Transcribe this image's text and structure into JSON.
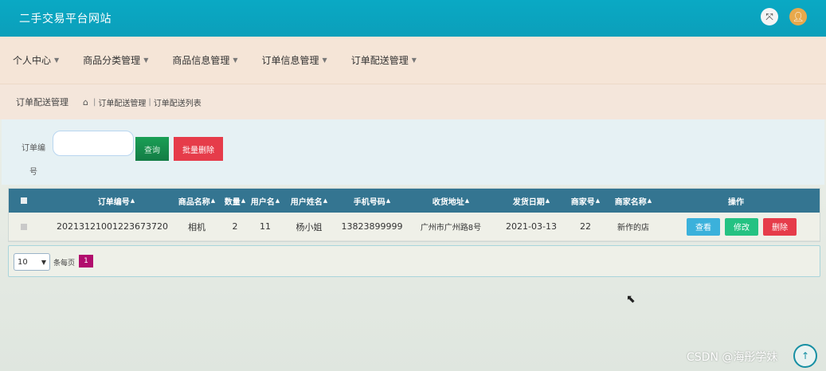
{
  "header": {
    "title": "二手交易平台网站",
    "fullscreen_icon": "fullscreen-icon",
    "user_icon": "user-icon"
  },
  "nav": {
    "items": [
      {
        "label": "个人中心"
      },
      {
        "label": "商品分类管理"
      },
      {
        "label": "商品信息管理"
      },
      {
        "label": "订单信息管理"
      },
      {
        "label": "订单配送管理"
      }
    ]
  },
  "breadcrumb": {
    "current": "订单配送管理",
    "path": [
      "订单配送管理",
      "订单配送列表"
    ]
  },
  "search": {
    "label_line1": "订单编",
    "label_line2": "号",
    "input_value": "",
    "search_label": "查询",
    "batch_delete_label": "批量删除"
  },
  "table": {
    "headers": [
      "订单编号",
      "商品名称",
      "数量",
      "用户名",
      "用户姓名",
      "手机号码",
      "收货地址",
      "发货日期",
      "商家号",
      "商家名称",
      "操作"
    ],
    "rows": [
      {
        "order_no": "20213121001223673720",
        "product": "相机",
        "qty": "2",
        "username": "11",
        "name": "杨小姐",
        "phone": "13823899999",
        "address": "广州市广州路8号",
        "ship_date": "2021-03-13",
        "merchant_no": "22",
        "merchant_name": "新作的店",
        "view_label": "查看",
        "edit_label": "修改",
        "delete_label": "删除"
      }
    ]
  },
  "pager": {
    "page_size": "10",
    "per_page_label": "条每页",
    "current_page": "1"
  },
  "watermark": "CSDN @海彤学妹",
  "colors": {
    "topbar": "#0aa9c4",
    "table_header": "#347591",
    "danger": "#e63c4a",
    "success": "#25c282",
    "info": "#3bb1db",
    "page_active": "#b10d6d"
  }
}
